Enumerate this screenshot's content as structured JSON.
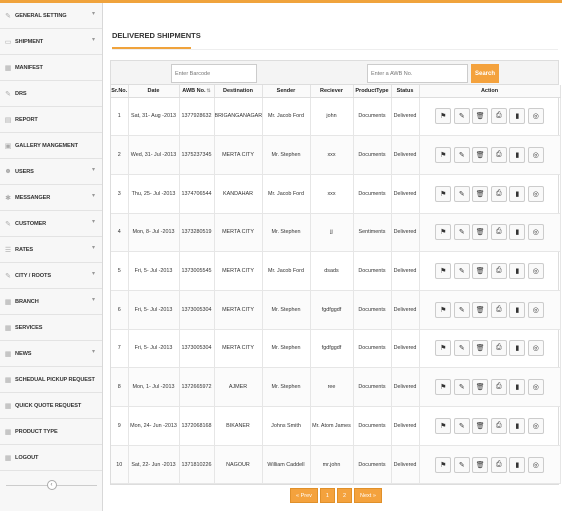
{
  "sidebar": {
    "items": [
      {
        "label": "GENERAL SETTING",
        "icon": "pencil-icon",
        "chevron": true
      },
      {
        "label": "SHIPMENT",
        "icon": "truck-icon",
        "chevron": true
      },
      {
        "label": "MANIFEST",
        "icon": "grid-icon",
        "chevron": false
      },
      {
        "label": "DRS",
        "icon": "pencil-icon",
        "chevron": false
      },
      {
        "label": "REPORT",
        "icon": "document-icon",
        "chevron": false
      },
      {
        "label": "GALLERY MANGEMENT",
        "icon": "image-icon",
        "chevron": false
      },
      {
        "label": "USERS",
        "icon": "user-icon",
        "chevron": true
      },
      {
        "label": "MESSANGER",
        "icon": "gear-icon",
        "chevron": true
      },
      {
        "label": "CUSTOMER",
        "icon": "pencil-icon",
        "chevron": true
      },
      {
        "label": "RATES",
        "icon": "list-icon",
        "chevron": true
      },
      {
        "label": "CITY / ROOTS",
        "icon": "pencil-icon",
        "chevron": true
      },
      {
        "label": "BRANCH",
        "icon": "grid-icon",
        "chevron": true
      },
      {
        "label": "SERVICES",
        "icon": "grid-icon",
        "chevron": false
      },
      {
        "label": "NEWS",
        "icon": "grid-icon",
        "chevron": true
      },
      {
        "label": "SCHEDUAL PICKUP REQUEST",
        "icon": "grid-icon",
        "chevron": false
      },
      {
        "label": "QUICK QUOTE REQUEST",
        "icon": "grid-icon",
        "chevron": false
      },
      {
        "label": "PRODUCT TYPE",
        "icon": "grid-icon",
        "chevron": false
      },
      {
        "label": "LOGOUT",
        "icon": "grid-icon",
        "chevron": false
      }
    ],
    "collapse_icon": "chevron-left-icon"
  },
  "main": {
    "title": "DELIVERED SHIPMENTS",
    "barcode_placeholder": "Enter Barcode",
    "awb_placeholder": "Enter a AWB No.",
    "search_label": "Search",
    "columns": [
      "Sr.No.",
      "Date",
      "AWB No.",
      "Destination",
      "Sender",
      "Reciever",
      "ProductType",
      "Status",
      "Action"
    ],
    "rows": [
      {
        "sr": "1",
        "date": "Sat, 31- Aug -2013",
        "awb": "1377928632",
        "dest": "BRIGANGANAGAR",
        "sender": "Mr. Jacob Ford",
        "receiver": "john",
        "ptype": "Documents",
        "status": "Delivered"
      },
      {
        "sr": "2",
        "date": "Wed, 31- Jul -2013",
        "awb": "1375237345",
        "dest": "MERTA CITY",
        "sender": "Mr. Stephen",
        "receiver": "xxx",
        "ptype": "Documents",
        "status": "Delivered"
      },
      {
        "sr": "3",
        "date": "Thu, 25- Jul -2013",
        "awb": "1374706544",
        "dest": "KANDAHAR",
        "sender": "Mr. Jacob Ford",
        "receiver": "xxx",
        "ptype": "Documents",
        "status": "Delivered"
      },
      {
        "sr": "4",
        "date": "Mon, 8- Jul -2013",
        "awb": "1373280519",
        "dest": "MERTA CITY",
        "sender": "Mr. Stephen",
        "receiver": "jj",
        "ptype": "Sentiments",
        "status": "Delivered"
      },
      {
        "sr": "5",
        "date": "Fri, 5- Jul -2013",
        "awb": "1373005545",
        "dest": "MERTA CITY",
        "sender": "Mr. Jacob Ford",
        "receiver": "dsads",
        "ptype": "Documents",
        "status": "Delivered"
      },
      {
        "sr": "6",
        "date": "Fri, 5- Jul -2013",
        "awb": "1373005304",
        "dest": "MERTA CITY",
        "sender": "Mr. Stephen",
        "receiver": "fgdfggdf",
        "ptype": "Documents",
        "status": "Delivered"
      },
      {
        "sr": "7",
        "date": "Fri, 5- Jul -2013",
        "awb": "1373005304",
        "dest": "MERTA CITY",
        "sender": "Mr. Stephen",
        "receiver": "fgdfggdf",
        "ptype": "Documents",
        "status": "Delivered"
      },
      {
        "sr": "8",
        "date": "Mon, 1- Jul -2013",
        "awb": "1372665972",
        "dest": "AJMER",
        "sender": "Mr. Stephen",
        "receiver": "ree",
        "ptype": "Documents",
        "status": "Delivered"
      },
      {
        "sr": "9",
        "date": "Mon, 24- Jun -2013",
        "awb": "1372068168",
        "dest": "BIKANER",
        "sender": "Johns Smith",
        "receiver": "Mr. Atom James",
        "ptype": "Documents",
        "status": "Delivered"
      },
      {
        "sr": "10",
        "date": "Sat, 22- Jun -2013",
        "awb": "1371810226",
        "dest": "NAGOUR",
        "sender": "William Caddell",
        "receiver": "mr.john",
        "ptype": "Documents",
        "status": "Delivered"
      }
    ],
    "action_icons": [
      "flag-icon",
      "pencil-icon",
      "trash-icon",
      "print-icon",
      "book-icon",
      "globe-icon"
    ],
    "pagination": {
      "prev": "« Prev",
      "pages": [
        "1",
        "2"
      ],
      "next": "Next »"
    }
  },
  "colors": {
    "accent": "#f4a23d",
    "topbar": "#f0a33c"
  }
}
